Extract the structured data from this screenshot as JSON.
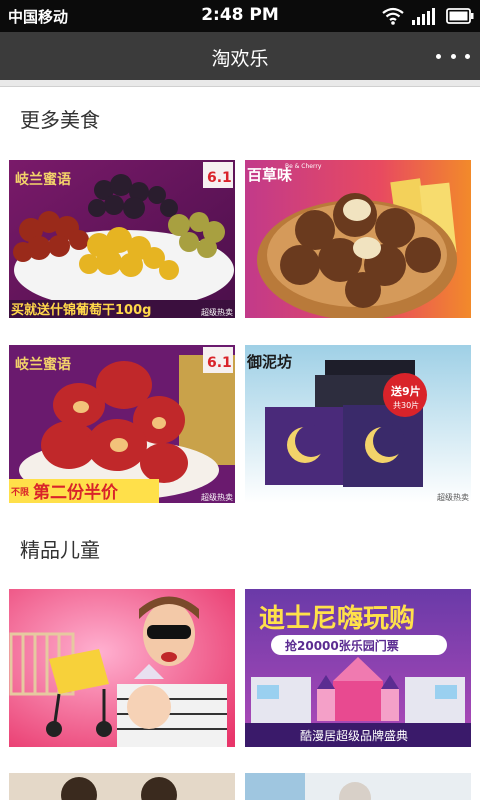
{
  "status_bar": {
    "carrier": "中国移动",
    "time": "2:48 PM"
  },
  "nav": {
    "title": "淘欢乐"
  },
  "sections": [
    {
      "title": "更多美食",
      "cards": [
        {
          "brand": "岐兰蜜语",
          "headline": "买就送什锦葡萄干100g",
          "tag": "超级热卖",
          "corner": "6.1"
        },
        {
          "brand": "百草味",
          "brand_en": "Be & Cherry",
          "tag": "",
          "corner": ""
        },
        {
          "brand": "岐兰蜜语",
          "headline": "第二份半价",
          "headline_prefix": "不限",
          "tag": "超级热卖",
          "corner": "6.1"
        },
        {
          "brand": "御泥坊",
          "badge": "送9片",
          "badge_sub": "共30片",
          "tag": "超级热卖"
        }
      ]
    },
    {
      "title": "精品儿童",
      "cards": [
        {
          "description": ""
        },
        {
          "headline": "迪士尼嗨玩购",
          "subheadline": "抢20000张乐园门票",
          "footer": "酷漫居超级品牌盛典"
        }
      ]
    }
  ],
  "colors": {
    "status_bar_bg": "#0b0b0b",
    "nav_bg": "#3b3b3b",
    "accent_red": "#d9232a",
    "accent_purple": "#5b2c91"
  }
}
